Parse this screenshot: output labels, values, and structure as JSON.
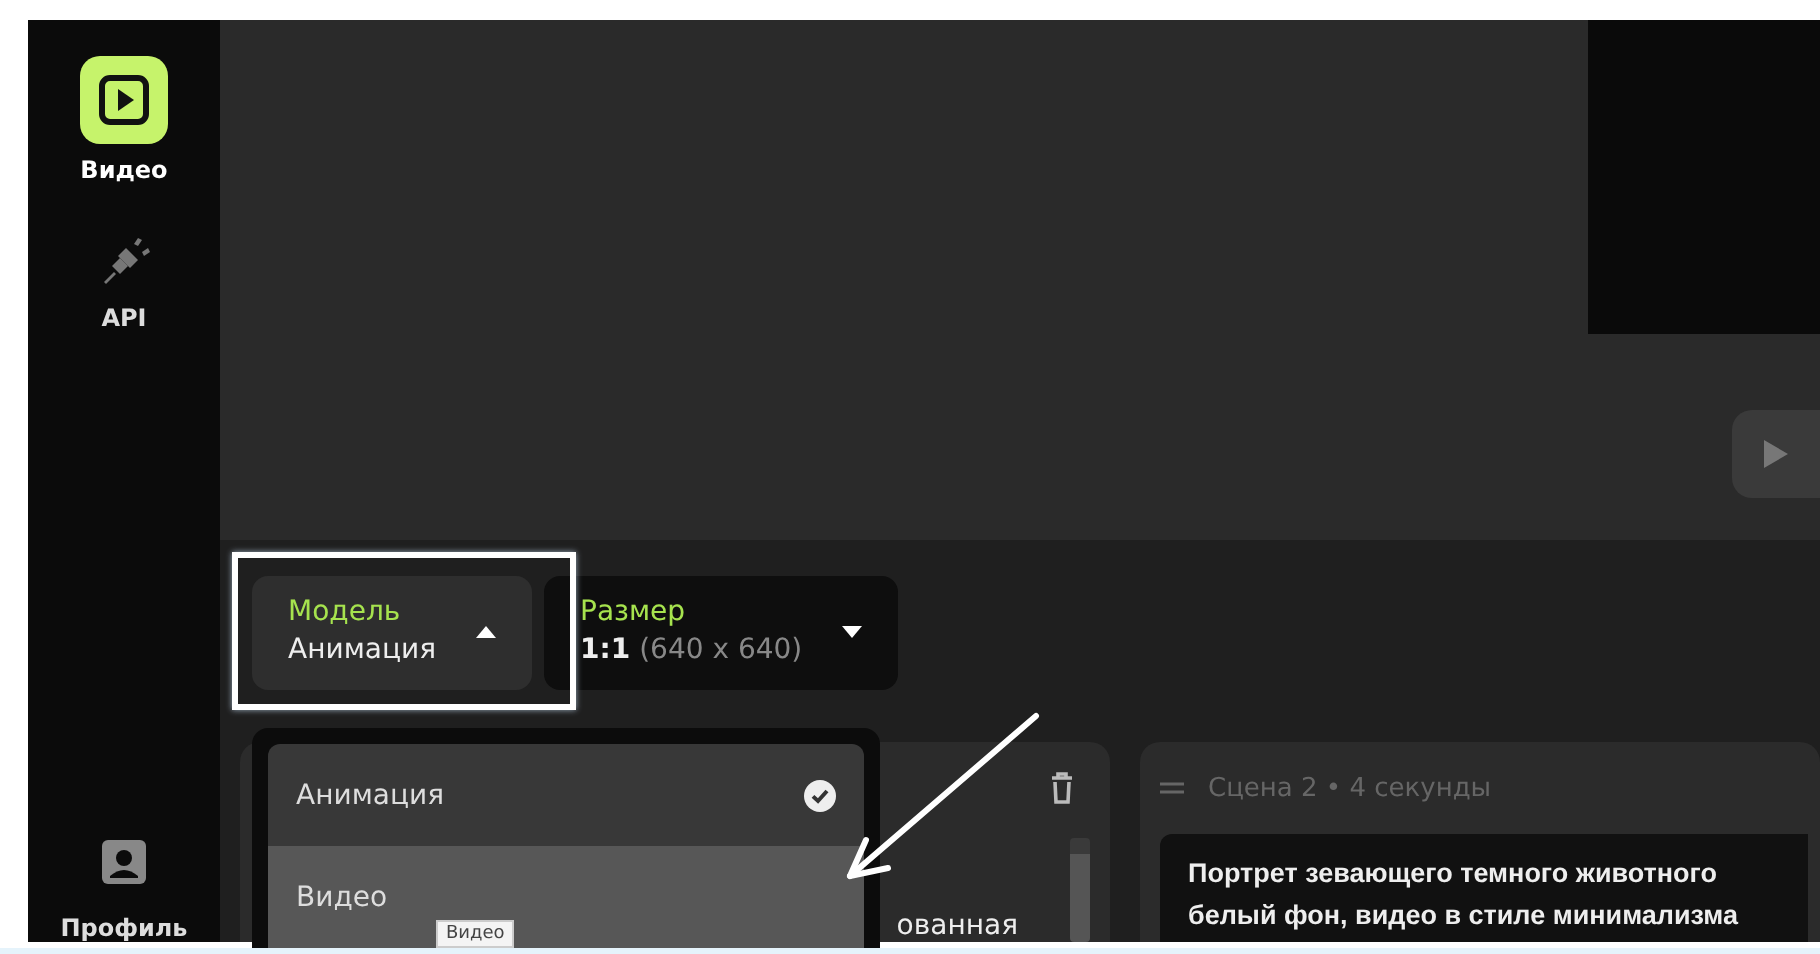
{
  "sidebar": {
    "items": [
      {
        "kind": "video",
        "label": "Видео",
        "selected": true
      },
      {
        "kind": "api",
        "label": "API",
        "selected": false
      }
    ],
    "profile": {
      "label": "Профиль"
    }
  },
  "controls": {
    "model": {
      "label": "Модель",
      "value": "Анимация",
      "open": true
    },
    "size": {
      "label": "Размер",
      "value": "1:1",
      "detail": "(640 x 640)",
      "open": false
    }
  },
  "model_menu": {
    "options": [
      {
        "label": "Анимация",
        "selected": true,
        "highlighted": false
      },
      {
        "label": "Видео",
        "selected": false,
        "highlighted": true
      }
    ],
    "tooltip": "Видео"
  },
  "scenes": [
    {
      "text": "ованная"
    },
    {
      "title": "Сцена 2 • 4 секунды",
      "text": "Портрет зевающего темного животного белый фон, видео в стиле минимализма"
    }
  ]
}
